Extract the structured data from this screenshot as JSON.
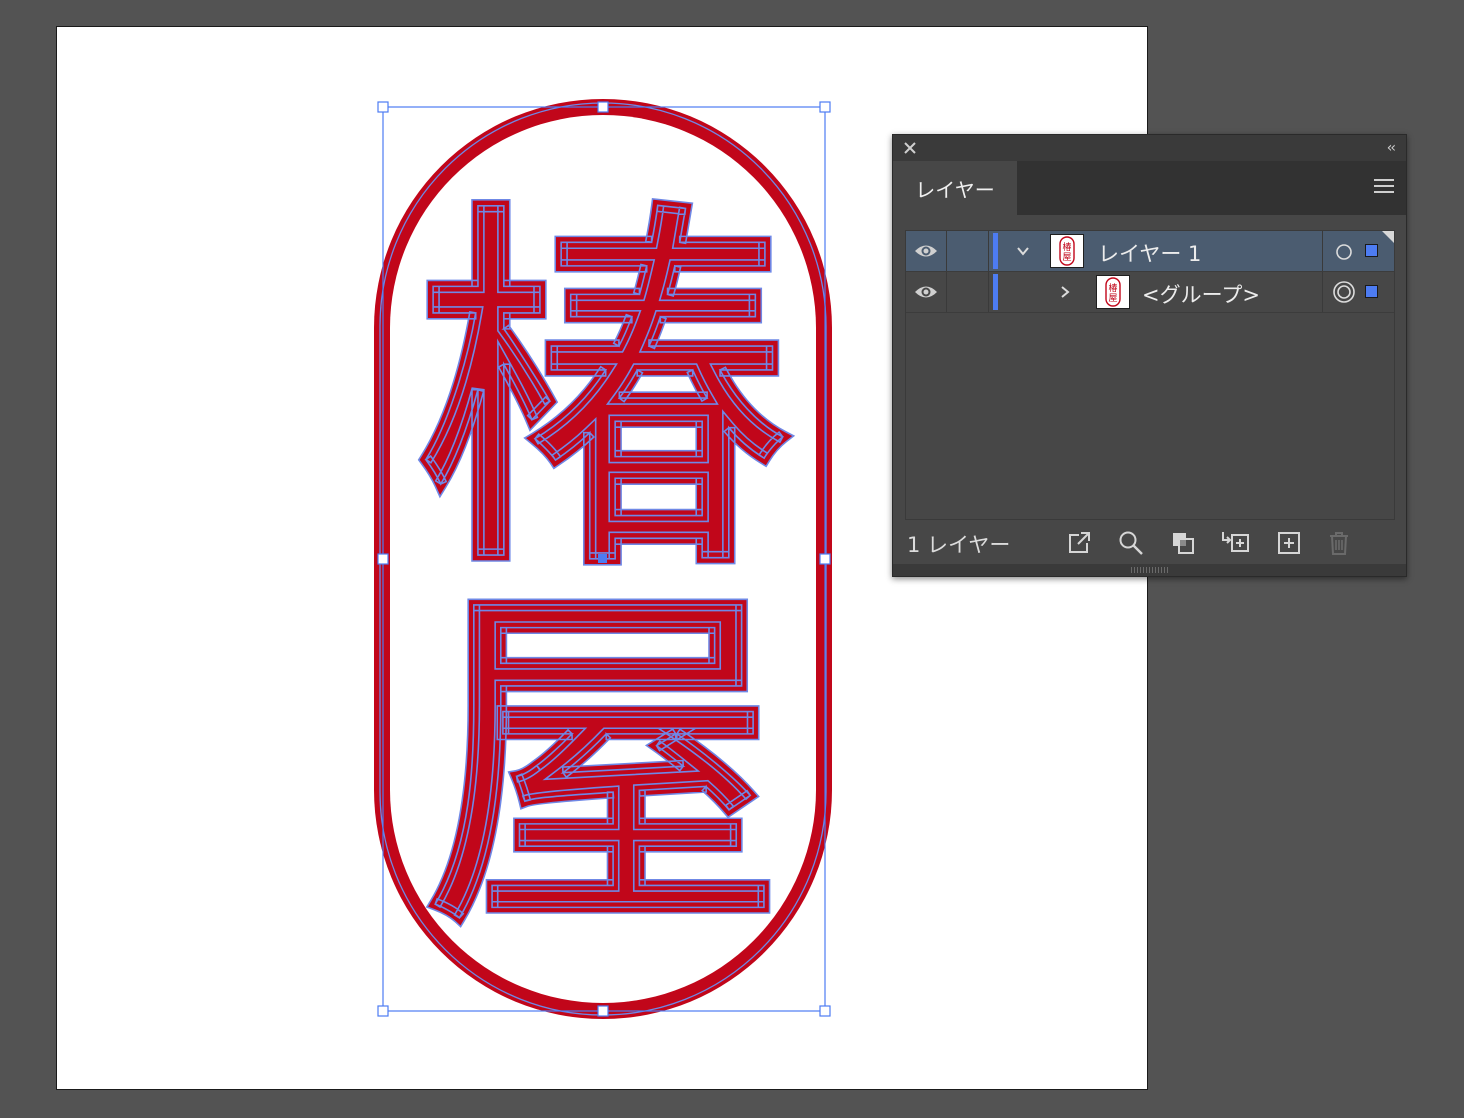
{
  "artboard": {
    "stamp": {
      "char_top": "椿",
      "char_bottom": "屋",
      "color": "#c1061a",
      "selection_color": "#4d7cf2"
    }
  },
  "layers_panel": {
    "tab_label": "レイヤー",
    "rows": [
      {
        "label": "レイヤー 1",
        "thumb_chars": "椿屋",
        "expanded": true,
        "selected": true
      },
      {
        "label": "<グループ>",
        "thumb_chars": "椿屋",
        "expanded": false,
        "selected": false
      }
    ],
    "footer": {
      "layer_count": "1 レイヤー"
    },
    "icons": [
      "close-icon",
      "collapse-icon",
      "menu-icon",
      "eye-icon",
      "chevron-down-icon",
      "chevron-right-icon",
      "target-icon",
      "export-icon",
      "search-icon",
      "clipping-mask-icon",
      "new-sublayer-icon",
      "new-layer-icon",
      "trash-icon"
    ]
  }
}
